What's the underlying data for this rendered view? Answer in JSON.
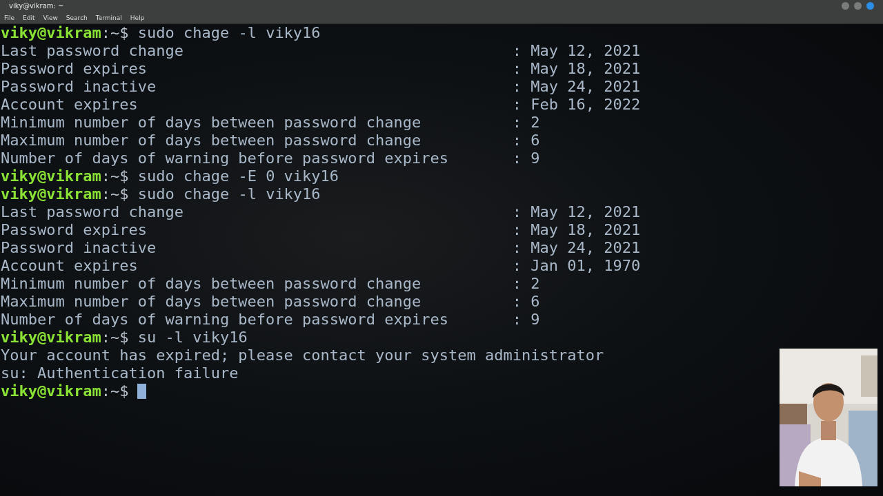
{
  "window": {
    "title": "viky@vikram: ~"
  },
  "menu": [
    "File",
    "Edit",
    "View",
    "Search",
    "Terminal",
    "Help"
  ],
  "terminal": {
    "lines": [
      {
        "kind": "prompt",
        "user_host": "viky@vikram",
        "path": ":~$",
        "command": "sudo chage -l viky16"
      },
      {
        "kind": "output",
        "text": "Last password change                                    : May 12, 2021"
      },
      {
        "kind": "output",
        "text": "Password expires                                        : May 18, 2021"
      },
      {
        "kind": "output",
        "text": "Password inactive                                       : May 24, 2021"
      },
      {
        "kind": "output",
        "text": "Account expires                                         : Feb 16, 2022"
      },
      {
        "kind": "output",
        "text": "Minimum number of days between password change          : 2"
      },
      {
        "kind": "output",
        "text": "Maximum number of days between password change          : 6"
      },
      {
        "kind": "output",
        "text": "Number of days of warning before password expires       : 9"
      },
      {
        "kind": "prompt",
        "user_host": "viky@vikram",
        "path": ":~$",
        "command": "sudo chage -E 0 viky16"
      },
      {
        "kind": "prompt",
        "user_host": "viky@vikram",
        "path": ":~$",
        "command": "sudo chage -l viky16"
      },
      {
        "kind": "output",
        "text": "Last password change                                    : May 12, 2021"
      },
      {
        "kind": "output",
        "text": "Password expires                                        : May 18, 2021"
      },
      {
        "kind": "output",
        "text": "Password inactive                                       : May 24, 2021"
      },
      {
        "kind": "output",
        "text": "Account expires                                         : Jan 01, 1970"
      },
      {
        "kind": "output",
        "text": "Minimum number of days between password change          : 2"
      },
      {
        "kind": "output",
        "text": "Maximum number of days between password change          : 6"
      },
      {
        "kind": "output",
        "text": "Number of days of warning before password expires       : 9"
      },
      {
        "kind": "prompt",
        "user_host": "viky@vikram",
        "path": ":~$",
        "command": "su -l viky16"
      },
      {
        "kind": "output",
        "text": "Your account has expired; please contact your system administrator"
      },
      {
        "kind": "output",
        "text": "su: Authentication failure"
      },
      {
        "kind": "prompt",
        "user_host": "viky@vikram",
        "path": ":~$",
        "cursor": true
      }
    ]
  }
}
